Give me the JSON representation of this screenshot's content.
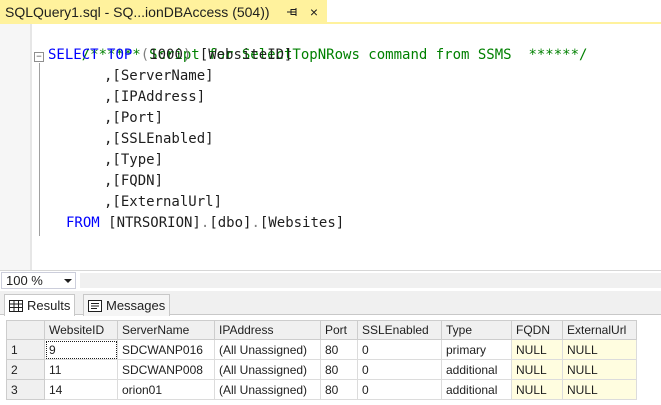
{
  "tab": {
    "title": "SQLQuery1.sql - SQ...ionDBAccess (504))",
    "pin_glyph": "⊣",
    "close_glyph": "×"
  },
  "editor": {
    "comment": "/****** Script for SelectTopNRows command from SSMS  ******/",
    "select_kw": "SELECT",
    "top_kw": "TOP",
    "top_open": "(",
    "top_value": "1000",
    "top_close": ")",
    "first_column": " [WebsiteID]",
    "columns": [
      ",[ServerName]",
      ",[IPAddress]",
      ",[Port]",
      ",[SSLEnabled]",
      ",[Type]",
      ",[FQDN]",
      ",[ExternalUrl]"
    ],
    "from_kw": "FROM",
    "from_db": " [NTRSORION]",
    "from_schema": "[dbo]",
    "from_table": "[Websites]",
    "dot": "."
  },
  "zoom": {
    "value": "100 %"
  },
  "result_tabs": [
    {
      "label": "Results",
      "icon": "grid-icon",
      "active": true
    },
    {
      "label": "Messages",
      "icon": "messages-icon",
      "active": false
    }
  ],
  "grid": {
    "columns": [
      "WebsiteID",
      "ServerName",
      "IPAddress",
      "Port",
      "SSLEnabled",
      "Type",
      "FQDN",
      "ExternalUrl"
    ],
    "rows": [
      {
        "num": "1",
        "cells": [
          "9",
          "SDCWANP016",
          "(All Unassigned)",
          "80",
          "0",
          "primary",
          "NULL",
          "NULL"
        ]
      },
      {
        "num": "2",
        "cells": [
          "11",
          "SDCWANP008",
          "(All Unassigned)",
          "80",
          "0",
          "additional",
          "NULL",
          "NULL"
        ]
      },
      {
        "num": "3",
        "cells": [
          "14",
          "orion01",
          "(All Unassigned)",
          "80",
          "0",
          "additional",
          "NULL",
          "NULL"
        ]
      }
    ]
  },
  "colors": {
    "tab_active": "#fff29d",
    "keyword": "#0000ff",
    "comment": "#008000",
    "null_cell": "#fffde0"
  }
}
